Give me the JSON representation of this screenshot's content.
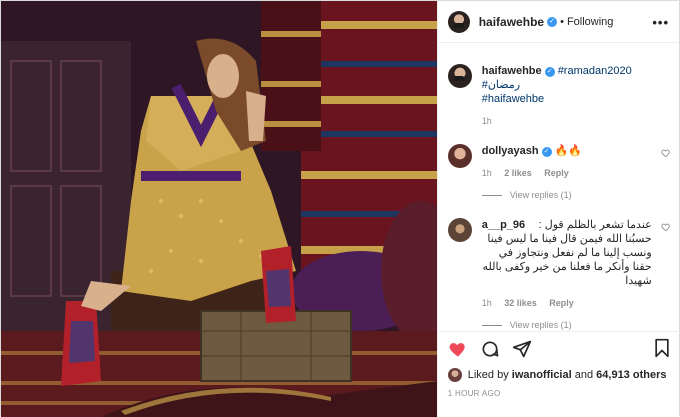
{
  "header": {
    "username": "haifawehbe",
    "separator": "•",
    "follow_status": "Following",
    "more_label": "•••"
  },
  "caption": {
    "username": "haifawehbe",
    "hashtag1": "#ramadan2020",
    "hashtag2": "#رمضان",
    "hashtag3": "#haifawehbe",
    "time": "1h"
  },
  "comments": [
    {
      "username": "dollyayash",
      "text": "🔥🔥",
      "time": "1h",
      "likes": "2 likes",
      "reply": "Reply",
      "view_replies": "View replies (1)"
    },
    {
      "username": "a__p_96",
      "text": "عندما تشعر بالظلم قول : حسبُنا الله فيمن قال فينا ما ليس فينا ونسب إلينا ما لم نفعل ونتجاوز في حقنا وأنكر ما فعلنا من خير وكفى بالله شهيدا",
      "time": "1h",
      "likes": "32 likes",
      "reply": "Reply",
      "view_replies": "View replies (1)"
    }
  ],
  "likes": {
    "prefix": "Liked by ",
    "user": "iwanofficial",
    "middle": " and ",
    "count": "64,913 others"
  },
  "posted": "1 HOUR AGO",
  "icons": {
    "like": "heart-icon",
    "comment": "comment-icon",
    "share": "share-icon",
    "save": "bookmark-icon"
  },
  "colors": {
    "heart": "#ed4956",
    "verified": "#3897f0",
    "muted": "#8e8e8e",
    "hashtag": "#00376b"
  }
}
